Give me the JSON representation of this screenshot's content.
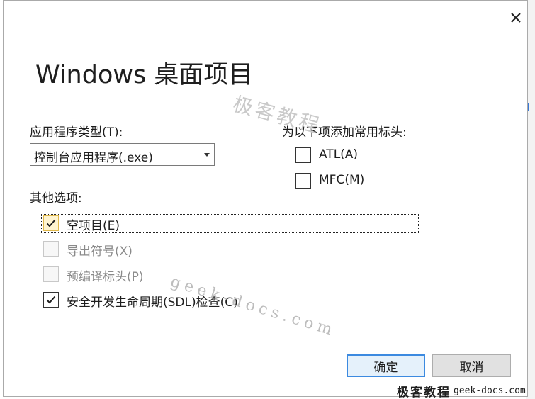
{
  "dialog": {
    "title": "Windows 桌面项目",
    "close_icon": "close-icon"
  },
  "app_type": {
    "label": "应用程序类型(T):",
    "selected": "控制台应用程序(.exe)"
  },
  "headers": {
    "label": "为以下项添加常用标头:",
    "items": [
      {
        "label": "ATL(A)",
        "checked": false,
        "enabled": true
      },
      {
        "label": "MFC(M)",
        "checked": false,
        "enabled": true
      }
    ]
  },
  "other_options": {
    "label": "其他选项:",
    "items": [
      {
        "label": "空项目(E)",
        "checked": true,
        "enabled": true,
        "focused": true
      },
      {
        "label": "导出符号(X)",
        "checked": false,
        "enabled": false
      },
      {
        "label": "预编译标头(P)",
        "checked": false,
        "enabled": false
      },
      {
        "label": "安全开发生命周期(SDL)检查(C)",
        "checked": true,
        "enabled": true
      }
    ]
  },
  "buttons": {
    "ok": "确定",
    "cancel": "取消"
  },
  "watermark": {
    "cn": "极客教程",
    "en": "geek-docs.com",
    "footer_cn": "极客教程",
    "footer_en": "geek-docs.com"
  },
  "colors": {
    "primary_border": "#3c8ae0",
    "focus_check_bg": "#fff4cf",
    "disabled_text": "#8a8a8a"
  }
}
